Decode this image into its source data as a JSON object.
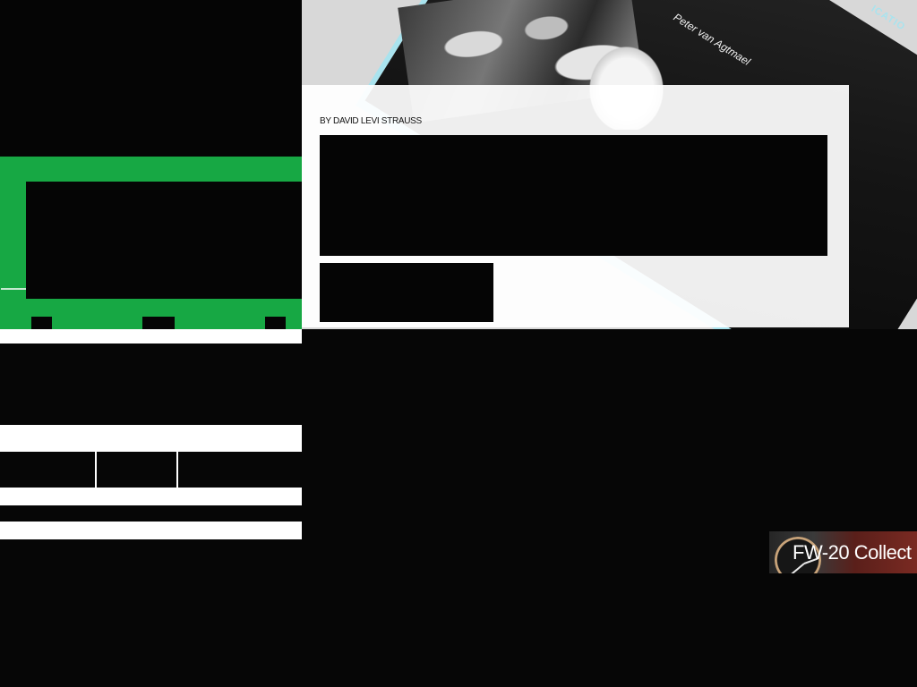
{
  "article": {
    "byline": "BY DAVID LEVI STRAUSS"
  },
  "hero": {
    "book_author": "Peter van Agtmael",
    "book_title_fragment": "ICATIO"
  },
  "ad": {
    "text": "FW-20 Collect"
  },
  "colors": {
    "green_accent": "#17a844",
    "page_background": "#060606",
    "book_spine": "#a9e3ee"
  },
  "icons": [
    "watch-icon"
  ]
}
